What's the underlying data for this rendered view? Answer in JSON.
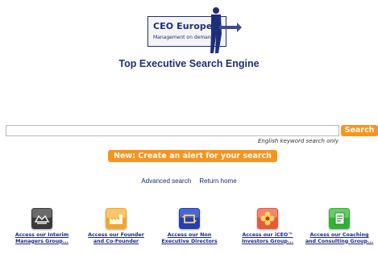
{
  "logo": {
    "title": "CEO Europe",
    "subtitle": "Management on demand"
  },
  "headline": "Top Executive Search Engine",
  "search": {
    "value": "",
    "button_label": "Search",
    "hint": "English keyword search only"
  },
  "alert_button": "New: Create an alert for your search",
  "links": {
    "advanced": "Advanced search",
    "home": "Return home"
  },
  "groups": [
    {
      "icon": "handshake-icon",
      "color": "#3a3a3a",
      "line1": "Access our Interim",
      "line2": "Managers Group..."
    },
    {
      "icon": "factory-icon",
      "color": "#f2a62a",
      "line1": "Access our Founder",
      "line2": "and Co-Founder"
    },
    {
      "icon": "exchange-icon",
      "color": "#2240b8",
      "line1": "Access our Non",
      "line2": "Executive Directors"
    },
    {
      "icon": "flower-icon",
      "color": "#e8583c",
      "line1": "Access our iCEO™",
      "line2": "Investors Group..."
    },
    {
      "icon": "document-icon",
      "color": "#33b038",
      "line1": "Access our Coaching",
      "line2": "and Consulting Group..."
    }
  ]
}
